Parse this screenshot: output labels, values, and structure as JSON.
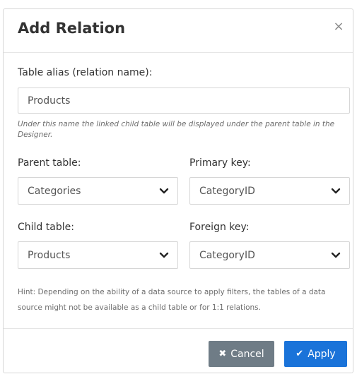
{
  "dialog": {
    "title": "Add Relation",
    "close_glyph": "×"
  },
  "alias": {
    "label": "Table alias (relation name):",
    "value": "Products",
    "helper": "Under this name the linked child table will be displayed under the parent table in the Designer."
  },
  "parent_table": {
    "label": "Parent table:",
    "value": "Categories"
  },
  "primary_key": {
    "label": "Primary key:",
    "value": "CategoryID"
  },
  "child_table": {
    "label": "Child table:",
    "value": "Products"
  },
  "foreign_key": {
    "label": "Foreign key:",
    "value": "CategoryID"
  },
  "hint": "Hint: Depending on the ability of a data source to apply filters, the tables of a data source might not be available as a child table or for 1:1 relations.",
  "footer": {
    "cancel_label": "Cancel",
    "cancel_icon": "x-icon",
    "apply_label": "Apply",
    "apply_icon": "check-icon"
  },
  "colors": {
    "cancel_bg": "#6f7c86",
    "apply_bg": "#1a73d9"
  }
}
